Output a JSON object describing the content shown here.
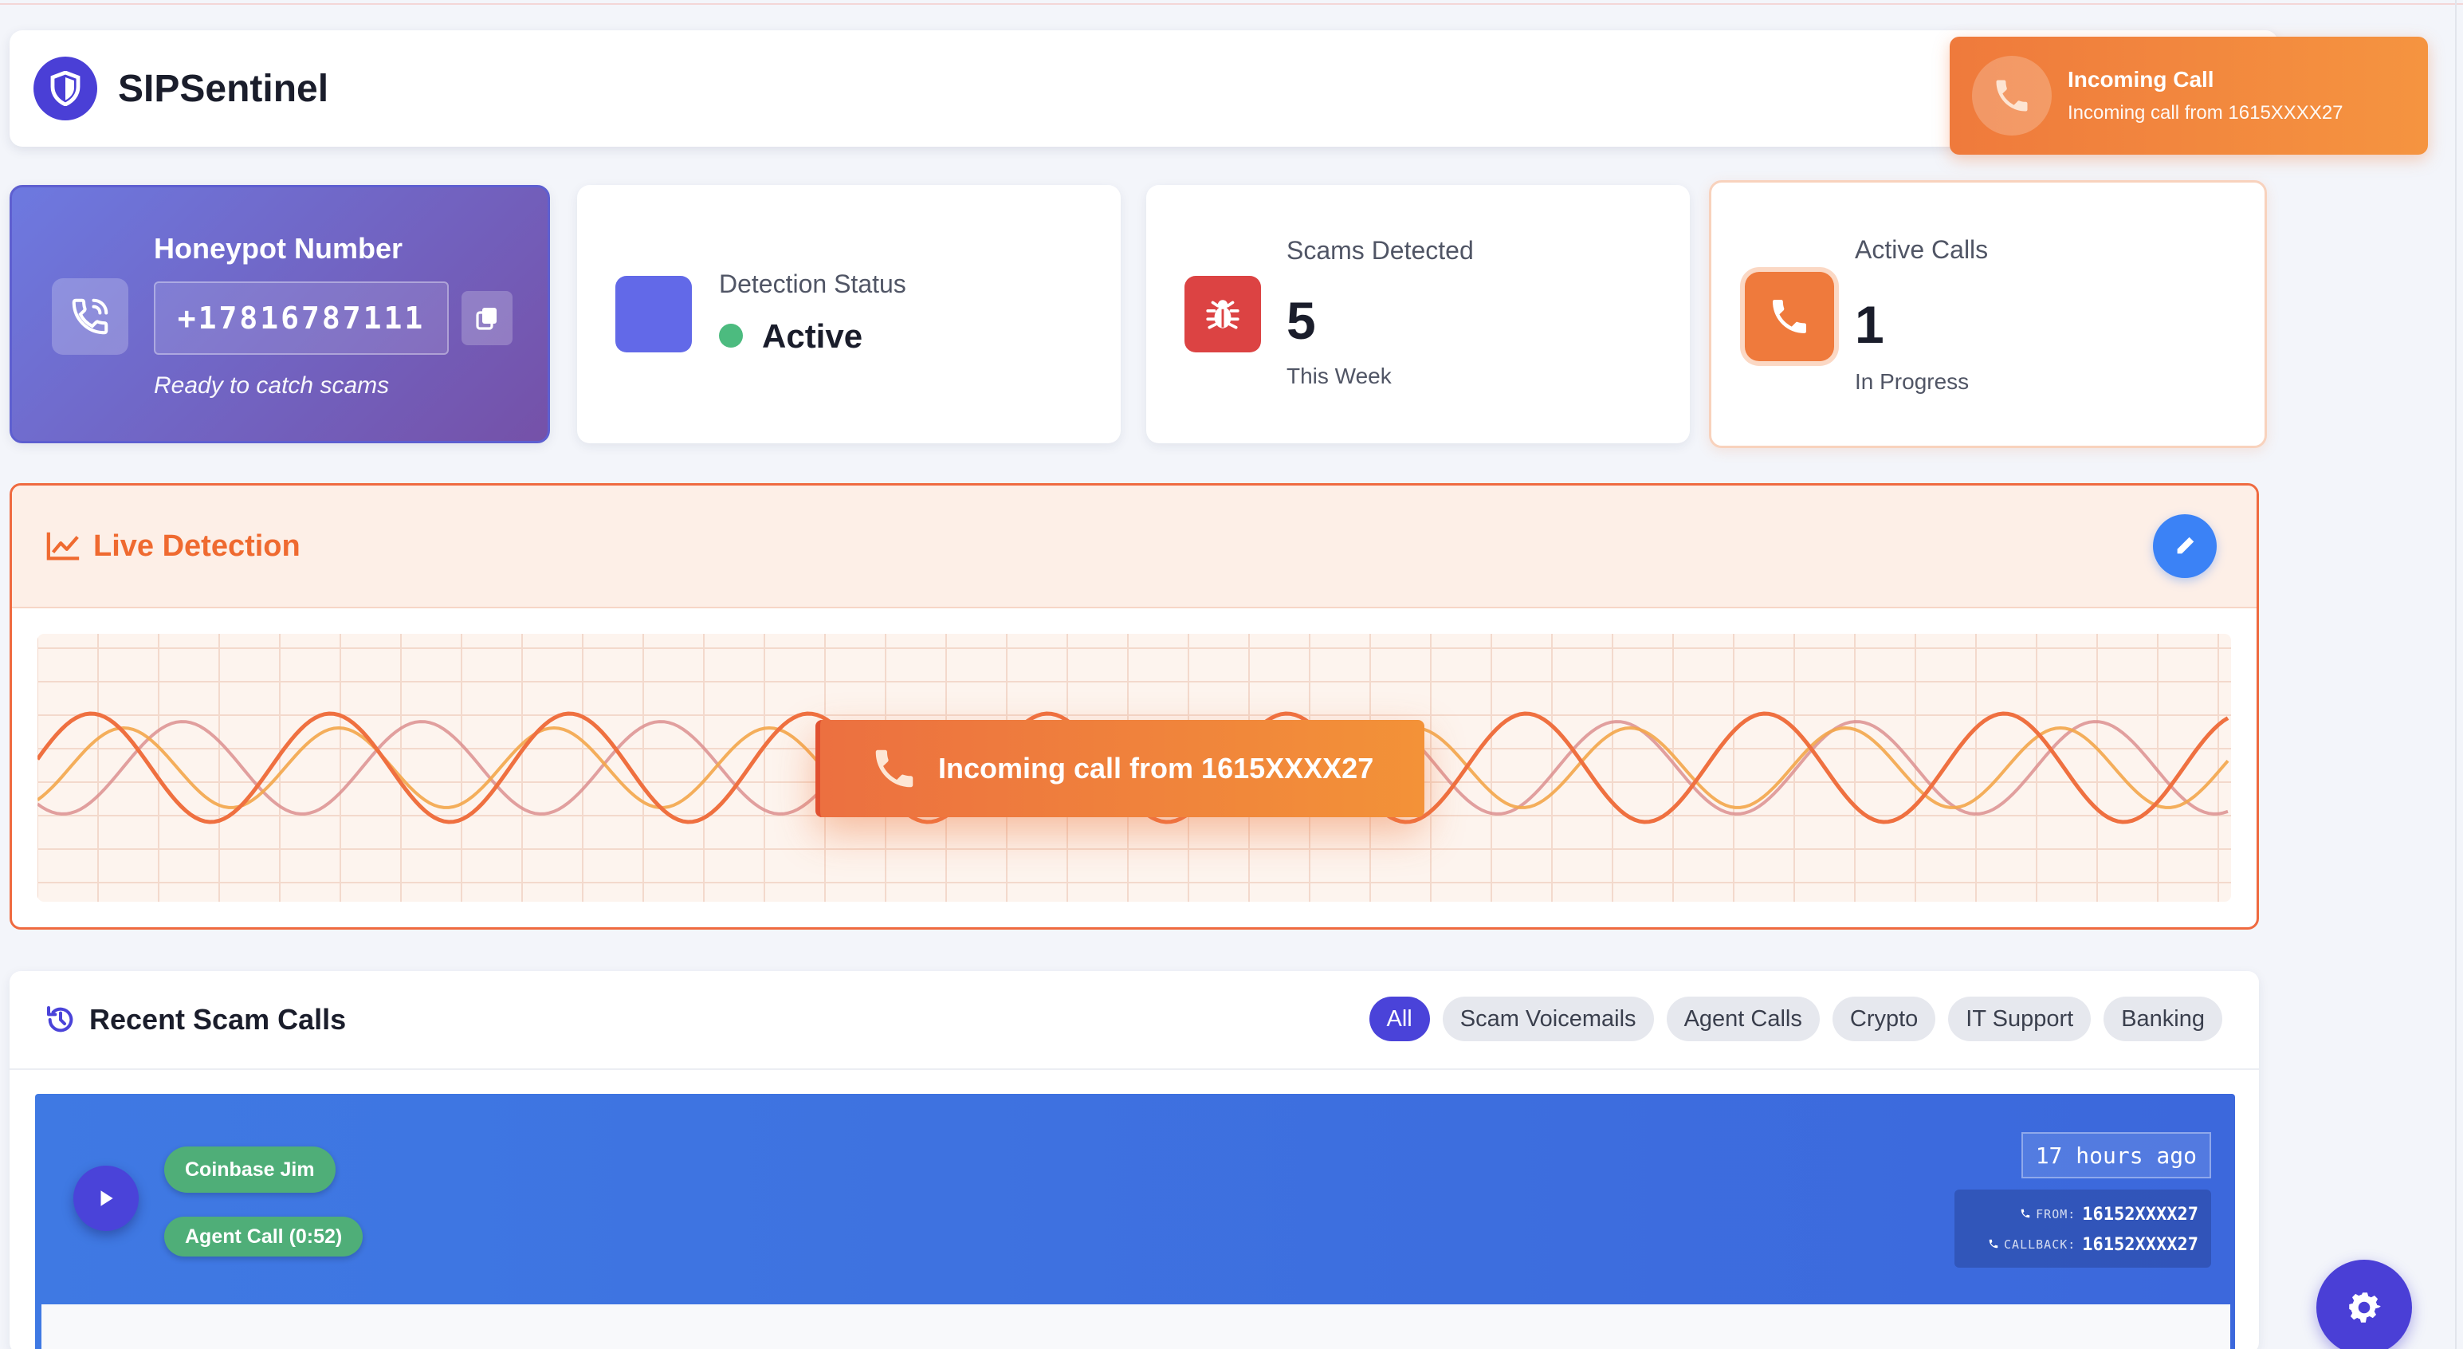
{
  "header": {
    "app_title": "SIPSentinel",
    "logo_icon": "shield-icon"
  },
  "toast": {
    "title": "Incoming Call",
    "message": "Incoming call from 1615XXXX27",
    "icon": "phone-icon"
  },
  "stats": {
    "honeypot": {
      "title": "Honeypot Number",
      "number": "+17816787111",
      "subtitle": "Ready to catch scams",
      "icon": "phone-ringing-icon"
    },
    "detection": {
      "label": "Detection Status",
      "value": "Active",
      "status_color": "#4cbb7f"
    },
    "scams": {
      "label": "Scams Detected",
      "value": "5",
      "subtitle": "This Week",
      "icon": "bug-icon"
    },
    "active_calls": {
      "label": "Active Calls",
      "value": "1",
      "subtitle": "In Progress",
      "icon": "phone-icon"
    }
  },
  "live": {
    "title": "Live Detection",
    "overlay_text": "Incoming call from 1615XXXX27",
    "accent": "#ef6a30"
  },
  "recent": {
    "title": "Recent Scam Calls",
    "filters": [
      "All",
      "Scam Voicemails",
      "Agent Calls",
      "Crypto",
      "IT Support",
      "Banking"
    ],
    "active_filter": "All",
    "calls": [
      {
        "name_tag": "Coinbase Jim",
        "type_tag": "Agent Call (0:52)",
        "time": "17 hours ago",
        "from_label": "FROM:",
        "from_value": "16152XXXX27",
        "callback_label": "CALLBACK:",
        "callback_value": "16152XXXX27"
      }
    ]
  },
  "colors": {
    "brand": "#4a3fd6",
    "orange": "#ef7a3c",
    "blue": "#3b82f6",
    "green": "#4fae78",
    "red": "#dc4343"
  }
}
